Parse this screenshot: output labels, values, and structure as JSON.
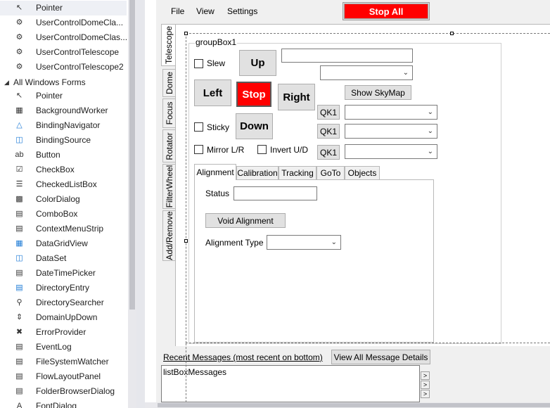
{
  "toolbox": {
    "items_top": [
      {
        "label": "Pointer",
        "icon": "pointer-icon",
        "selected": true
      },
      {
        "label": "UserControlDomeCla...",
        "icon": "component-icon"
      },
      {
        "label": "UserControlDomeClas...",
        "icon": "component-icon"
      },
      {
        "label": "UserControlTelescope",
        "icon": "component-icon"
      },
      {
        "label": "UserControlTelescope2",
        "icon": "component-icon"
      }
    ],
    "category": "All Windows Forms",
    "items": [
      {
        "label": "Pointer",
        "icon": "pointer-icon"
      },
      {
        "label": "BackgroundWorker",
        "icon": "background-worker-icon"
      },
      {
        "label": "BindingNavigator",
        "icon": "binding-navigator-icon"
      },
      {
        "label": "BindingSource",
        "icon": "binding-source-icon"
      },
      {
        "label": "Button",
        "icon": "button-icon"
      },
      {
        "label": "CheckBox",
        "icon": "checkbox-icon"
      },
      {
        "label": "CheckedListBox",
        "icon": "checked-listbox-icon"
      },
      {
        "label": "ColorDialog",
        "icon": "color-dialog-icon"
      },
      {
        "label": "ComboBox",
        "icon": "combobox-icon"
      },
      {
        "label": "ContextMenuStrip",
        "icon": "context-menu-icon"
      },
      {
        "label": "DataGridView",
        "icon": "datagrid-icon"
      },
      {
        "label": "DataSet",
        "icon": "dataset-icon"
      },
      {
        "label": "DateTimePicker",
        "icon": "datetime-picker-icon"
      },
      {
        "label": "DirectoryEntry",
        "icon": "directory-entry-icon"
      },
      {
        "label": "DirectorySearcher",
        "icon": "directory-searcher-icon"
      },
      {
        "label": "DomainUpDown",
        "icon": "domain-updown-icon"
      },
      {
        "label": "ErrorProvider",
        "icon": "error-provider-icon"
      },
      {
        "label": "EventLog",
        "icon": "event-log-icon"
      },
      {
        "label": "FileSystemWatcher",
        "icon": "filesystem-watcher-icon"
      },
      {
        "label": "FlowLayoutPanel",
        "icon": "flow-layout-icon"
      },
      {
        "label": "FolderBrowserDialog",
        "icon": "folder-browser-icon"
      },
      {
        "label": "FontDialog",
        "icon": "font-dialog-icon"
      }
    ]
  },
  "menu": {
    "file": "File",
    "view": "View",
    "settings": "Settings"
  },
  "stop_all": "Stop All",
  "vertical_tabs": [
    "Telescope",
    "Dome",
    "Focus",
    "Rotator",
    "FilterWheel",
    "Add/Remove"
  ],
  "groupbox": {
    "title": "groupBox1",
    "slew": "Slew",
    "up": "Up",
    "left": "Left",
    "stop": "Stop",
    "right": "Right",
    "down": "Down",
    "sticky": "Sticky",
    "mirror": "Mirror L/R",
    "invert": "Invert U/D",
    "show_skymap": "Show SkyMap",
    "qk": [
      "QK1",
      "QK1",
      "QK1"
    ]
  },
  "inner_tabs": [
    "Alignment",
    "Calibration",
    "Tracking",
    "GoTo",
    "Objects"
  ],
  "alignment": {
    "status_label": "Status",
    "void_alignment": "Void Alignment",
    "alignment_type_label": "Alignment Type"
  },
  "messages": {
    "label": "Recent Messages (most recent on bottom)",
    "view_all": "View All Message Details",
    "listbox_name": "listBoxMessages"
  },
  "colors": {
    "stop_red": "#ff0000"
  }
}
